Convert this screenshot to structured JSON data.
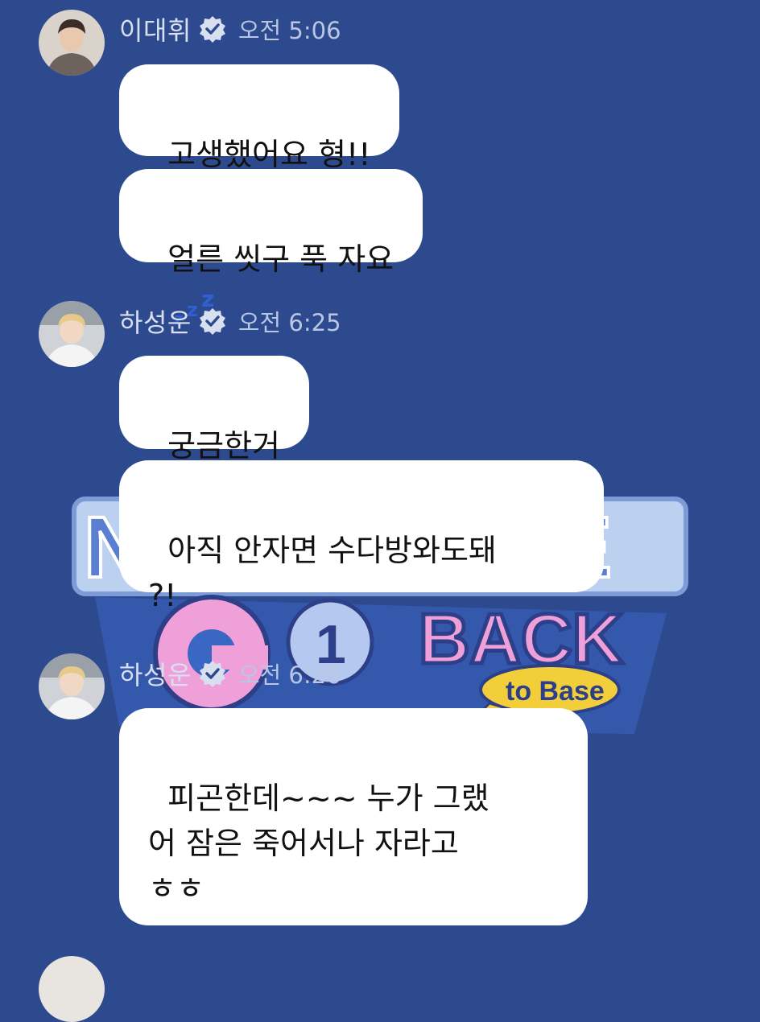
{
  "background_color": "#2e4a8f",
  "background_logo": {
    "line1": "NEW",
    "line2_a": "GO",
    "line2_b": "BACK",
    "badge": "to Base"
  },
  "messages": [
    {
      "sender": "이대휘",
      "avatar_icon": "profile-photo",
      "verified": true,
      "time": "오전 5:06",
      "bubbles": [
        "고생했어요 형!!",
        "얼른 씻구 푹 자요"
      ],
      "emoji": "zzz-sleep-icon"
    },
    {
      "sender": "하성운",
      "avatar_icon": "profile-photo",
      "verified": true,
      "time": "오전 6:25",
      "bubbles": [
        "궁금한거",
        "아직 안자면 수다방와도돼\n?!"
      ]
    },
    {
      "sender": "하성운",
      "avatar_icon": "profile-photo",
      "verified": true,
      "time": "오전 6:26",
      "bubbles": [
        "피곤한데~~~ 누가 그랬\n어 잠은 죽어서나 자라고\nㅎㅎ"
      ]
    }
  ]
}
